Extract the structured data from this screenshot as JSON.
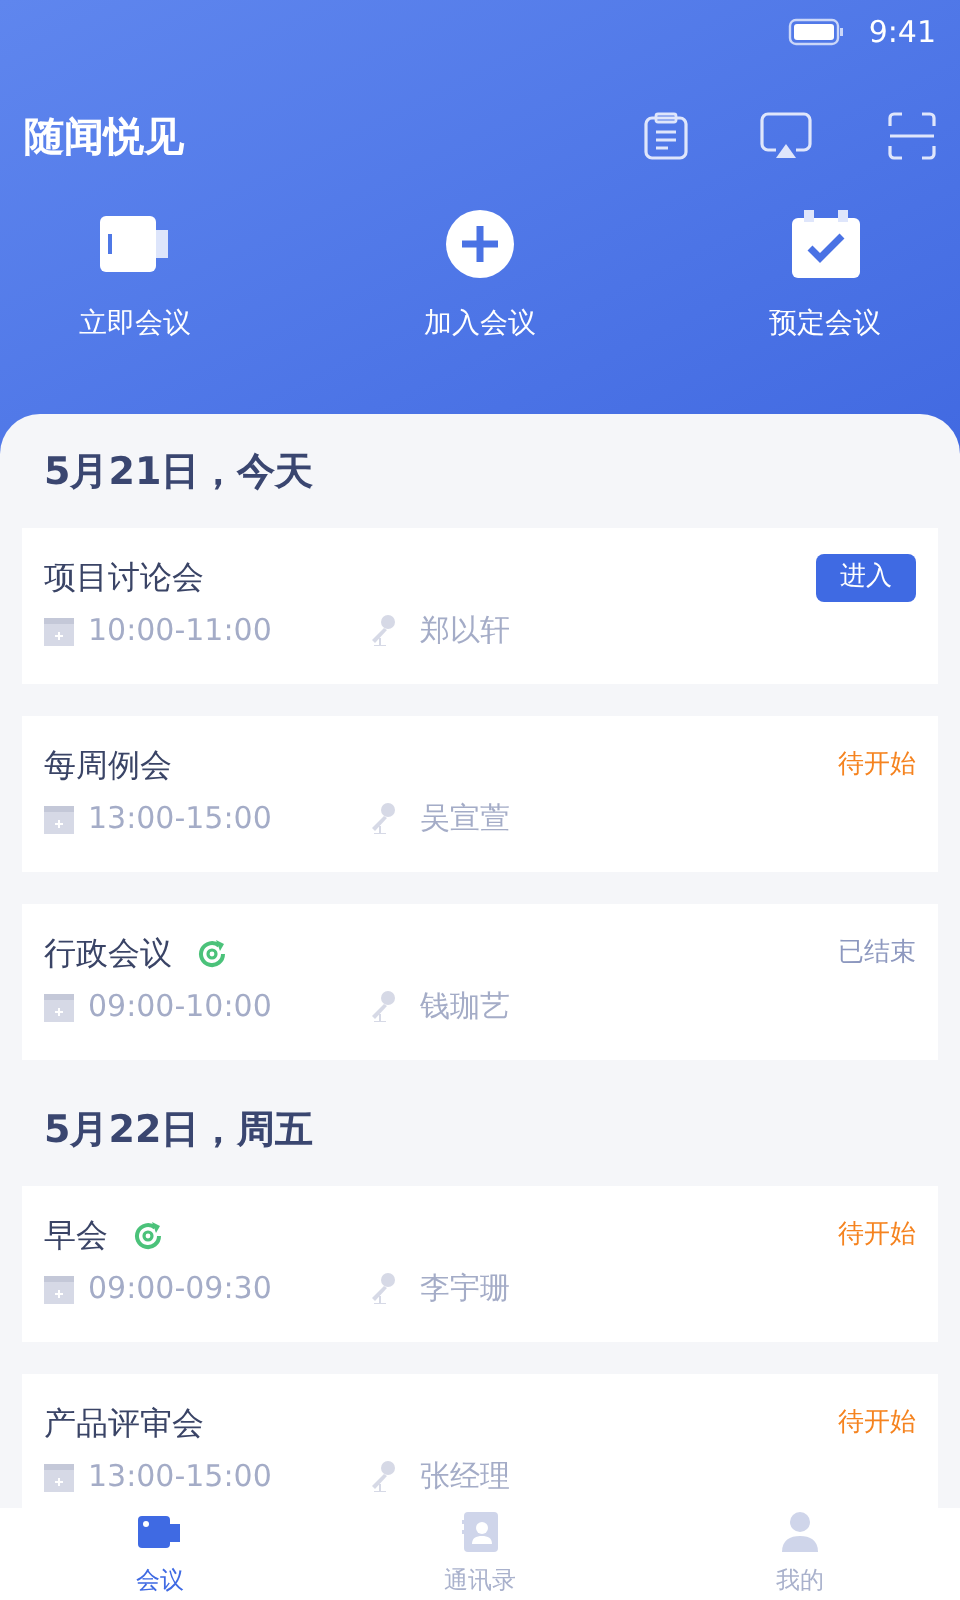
{
  "status_bar": {
    "time": "9:41"
  },
  "header": {
    "title": "随闻悦见"
  },
  "actions": [
    {
      "kind": "video",
      "label": "立即会议"
    },
    {
      "kind": "join",
      "label": "加入会议"
    },
    {
      "kind": "schedule",
      "label": "预定会议"
    }
  ],
  "days": [
    {
      "date": "5月21日，今天",
      "meetings": [
        {
          "title": "项目讨论会",
          "recurring": false,
          "time": "10:00-11:00",
          "host": "郑以轩",
          "status": {
            "kind": "enter",
            "label": "进入"
          }
        },
        {
          "title": "每周例会",
          "recurring": false,
          "time": "13:00-15:00",
          "host": "吴宣萱",
          "status": {
            "kind": "pending",
            "label": "待开始"
          }
        },
        {
          "title": "行政会议",
          "recurring": true,
          "time": "09:00-10:00",
          "host": "钱珈艺",
          "status": {
            "kind": "ended",
            "label": "已结束"
          }
        }
      ]
    },
    {
      "date": "5月22日，周五",
      "meetings": [
        {
          "title": "早会",
          "recurring": true,
          "time": "09:00-09:30",
          "host": "李宇珊",
          "status": {
            "kind": "pending",
            "label": "待开始"
          }
        },
        {
          "title": "产品评审会",
          "recurring": false,
          "time": "13:00-15:00",
          "host": "张经理",
          "status": {
            "kind": "pending",
            "label": "待开始"
          }
        }
      ]
    }
  ],
  "tab_bar": [
    {
      "kind": "meetings",
      "label": "会议",
      "selected": true
    },
    {
      "kind": "contacts",
      "label": "通讯录",
      "selected": false
    },
    {
      "kind": "me",
      "label": "我的",
      "selected": false
    }
  ]
}
